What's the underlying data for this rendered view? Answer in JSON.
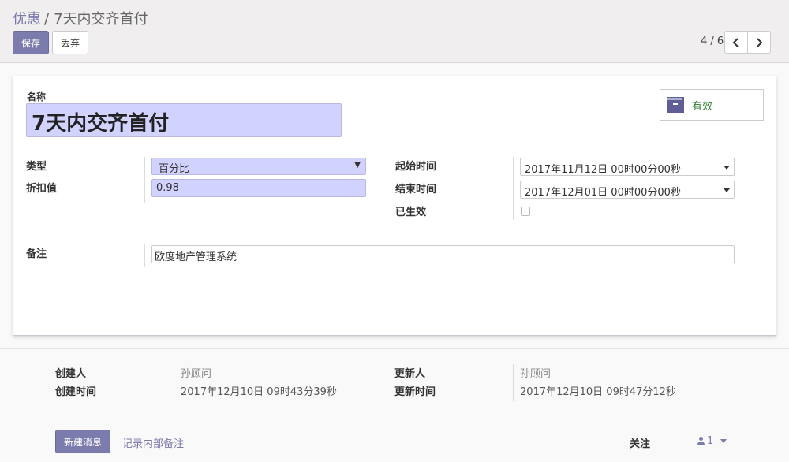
{
  "breadcrumb": {
    "parent": "优惠",
    "separator": "/",
    "current": "7天内交齐首付"
  },
  "toolbar": {
    "save_label": "保存",
    "discard_label": "丢弃"
  },
  "pager": {
    "value": "4 / 6"
  },
  "form": {
    "name_label": "名称",
    "name_value": "7天内交齐首付",
    "status_label": "有效",
    "type_label": "类型",
    "type_value": "百分比",
    "discount_label": "折扣值",
    "discount_value": "0.98",
    "start_label": "起始时间",
    "start_value": "2017年11月12日 00时00分00秒",
    "end_label": "结束时间",
    "end_value": "2017年12月01日 00时00分00秒",
    "active_label": "已生效",
    "active_checked": false,
    "note_label": "备注",
    "note_value": "欧度地产管理系统"
  },
  "meta": {
    "creator_label": "创建人",
    "creator_value": "孙顾问",
    "created_label": "创建时间",
    "created_value": "2017年12月10日 09时43分39秒",
    "updater_label": "更新人",
    "updater_value": "孙顾问",
    "updated_label": "更新时间",
    "updated_value": "2017年12月10日 09时47分12秒"
  },
  "chatter": {
    "new_message_label": "新建消息",
    "log_note_label": "记录内部备注",
    "follow_label": "关注",
    "followers_count": "1"
  }
}
